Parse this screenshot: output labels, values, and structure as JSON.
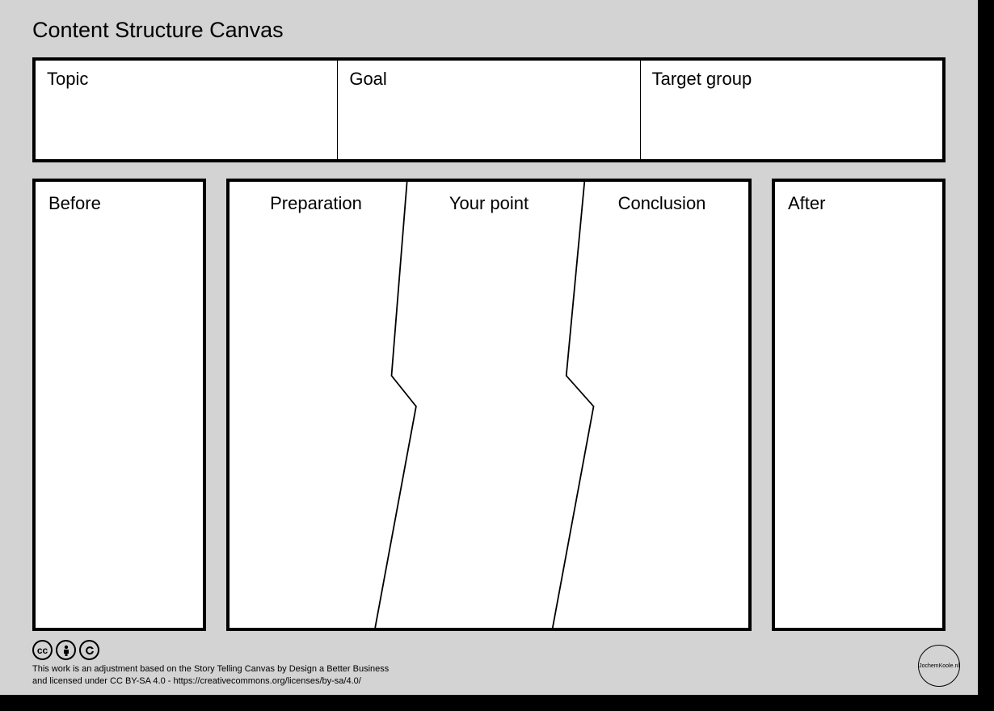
{
  "title": "Content Structure Canvas",
  "top": {
    "topic": "Topic",
    "goal": "Goal",
    "target_group": "Target group"
  },
  "main": {
    "before": "Before",
    "preparation": "Preparation",
    "your_point": "Your point",
    "conclusion": "Conclusion",
    "after": "After"
  },
  "footer": {
    "line1": "This work is an adjustment based on the Story Telling Canvas by Design a Better Business",
    "line2": "and licensed under CC BY-SA 4.0 - https://creativecommons.org/licenses/by-sa/4.0/"
  },
  "logo": "JochemKoole.nl",
  "cc": {
    "cc": "cc",
    "by": "by",
    "sa": "sa"
  }
}
